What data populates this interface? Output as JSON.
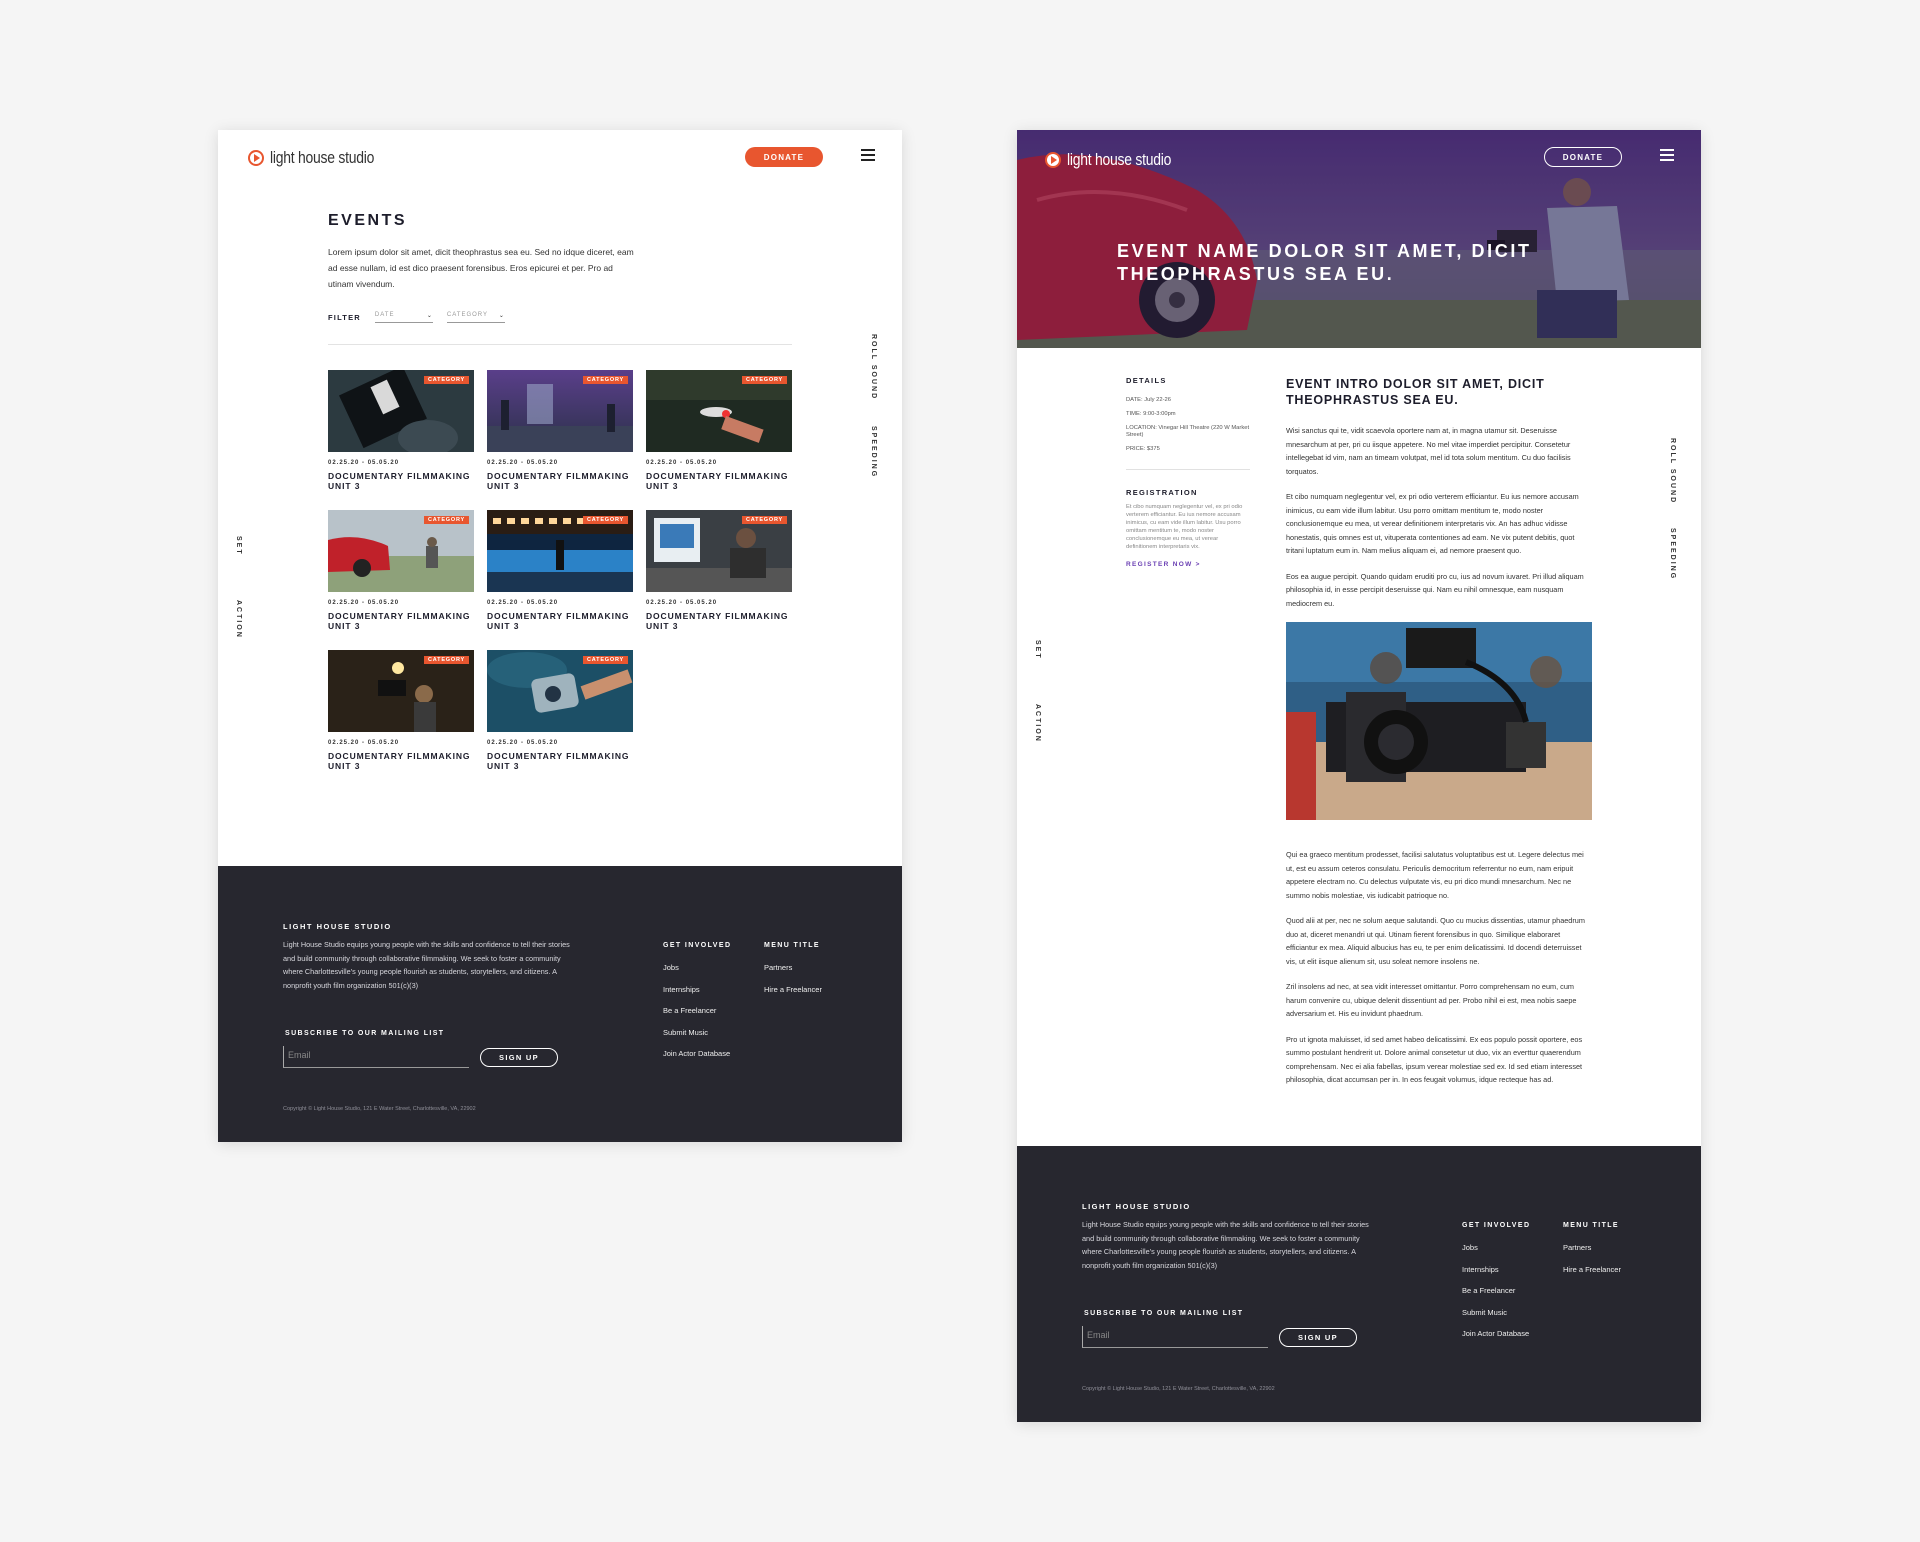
{
  "brand": {
    "logo_text": "light house studio",
    "accent": "#e8562f",
    "footer_bg": "#27272f",
    "link_color": "#6a3fb3"
  },
  "header": {
    "donate_label": "DONATE",
    "menu_icon": "hamburger-menu-icon"
  },
  "side_labels": {
    "set": "SET",
    "action": "ACTION",
    "roll_sound": "ROLL SOUND",
    "speeding": "SPEEDING"
  },
  "events": {
    "title": "EVENTS",
    "intro": "Lorem ipsum dolor sit amet, dicit theophrastus sea eu. Sed no idque diceret, eam ad esse nullam, id est dico praesent forensibus. Eros epicurei et per. Pro ad utinam vivendum.",
    "filter_label": "FILTER",
    "filter_date": "DATE",
    "filter_category": "CATEGORY",
    "cards": [
      {
        "tag": "CATEGORY",
        "date": "02.25.20 - 05.05.20",
        "title": "DOCUMENTARY FILMMAKING UNIT 3"
      },
      {
        "tag": "CATEGORY",
        "date": "02.25.20 - 05.05.20",
        "title": "DOCUMENTARY FILMMAKING UNIT 3"
      },
      {
        "tag": "CATEGORY",
        "date": "02.25.20 - 05.05.20",
        "title": "DOCUMENTARY FILMMAKING UNIT 3"
      },
      {
        "tag": "CATEGORY",
        "date": "02.25.20 - 05.05.20",
        "title": "DOCUMENTARY FILMMAKING UNIT 3"
      },
      {
        "tag": "CATEGORY",
        "date": "02.25.20 - 05.05.20",
        "title": "DOCUMENTARY FILMMAKING UNIT 3"
      },
      {
        "tag": "CATEGORY",
        "date": "02.25.20 - 05.05.20",
        "title": "DOCUMENTARY FILMMAKING UNIT 3"
      },
      {
        "tag": "CATEGORY",
        "date": "02.25.20 - 05.05.20",
        "title": "DOCUMENTARY FILMMAKING UNIT 3"
      },
      {
        "tag": "CATEGORY",
        "date": "02.25.20 - 05.05.20",
        "title": "DOCUMENTARY FILMMAKING UNIT 3"
      }
    ]
  },
  "detail": {
    "hero_title": "EVENT NAME DOLOR SIT AMET, DICIT THEOPHRASTUS SEA EU.",
    "details_label": "DETAILS",
    "date": "DATE: July 22-26",
    "time": "TIME: 9:00-3:00pm",
    "location": "LOCATION: Vinegar Hill Theatre (220 W Market Street)",
    "price": "PRICE: $375",
    "registration_label": "REGISTRATION",
    "registration_text": "Et cibo numquam neglegentur vel, ex pri odio verterem efficiantur. Eu ius nemore accusam inimicus, cu eam vide illum labitur. Usu porro omittam mentitum te, modo noster conclusionemque eu mea, ut verear definitionem interpretaris vix.",
    "register_link": "REGISTER NOW >",
    "intro_heading": "EVENT INTRO DOLOR SIT AMET, DICIT THEOPHRASTUS SEA EU.",
    "paragraphs": [
      "Wisi sanctus qui te, vidit scaevola oportere nam at, in magna utamur sit. Deseruisse mnesarchum at per, pri cu iisque appetere. No mel vitae imperdiet percipitur. Consetetur intellegebat id vim, nam an timeam volutpat, mel id tota solum mentitum. Cu duo facilisis torquatos.",
      "Et cibo numquam neglegentur vel, ex pri odio verterem efficiantur. Eu ius nemore accusam inimicus, cu eam vide illum labitur. Usu porro omittam mentitum te, modo noster conclusionemque eu mea, ut verear definitionem interpretaris vix. An has adhuc vidisse honestatis, quis omnes est ut, vituperata contentiones ad eam. Ne vix putent debitis, quot tritani luptatum eum in. Nam melius aliquam ei, ad nemore praesent quo.",
      "Eos ea augue percipit. Quando quidam eruditi pro cu, ius ad novum iuvaret. Pri illud aliquam philosophia id, in esse percipit deseruisse qui. Nam eu nihil omnesque, eam nusquam mediocrem eu."
    ],
    "lower_paragraphs": [
      "Qui ea graeco mentitum prodesset, facilisi salutatus voluptatibus est ut. Legere delectus mei ut, est eu assum ceteros consulatu. Periculis democritum referrentur no eum, nam eripuit appetere electram no. Cu delectus vulputate vis, eu pri dico mundi mnesarchum. Nec ne summo nobis molestiae, vis iudicabit patrioque no.",
      "Quod alii at per, nec ne solum aeque salutandi. Quo cu mucius dissentias, utamur phaedrum duo at, diceret menandri ut qui. Utinam fierent forensibus in quo. Similique elaboraret efficiantur ex mea. Aliquid albucius has eu, te per enim delicatissimi. Id docendi deterruisset vis, ut elit iisque alienum sit, usu soleat nemore insolens ne.",
      "Zril insolens ad nec, at sea vidit interesset omittantur. Porro comprehensam no eum, cum harum convenire cu, ubique delenit dissentiunt ad per. Probo nihil ei est, mea nobis saepe adversarium et. His eu invidunt phaedrum.",
      "Pro ut ignota maluisset, id sed amet habeo delicatissimi. Ex eos populo possit oportere, eos summo postulant hendrerit ut. Dolore animal consetetur ut duo, vix an everttur quaerendum comprehensam. Nec ei alia fabellas, ipsum verear molestiae sed ex. Id sed etiam interesset philosophia, dicat accumsan per in. In eos feugait volumus, idque recteque has ad."
    ]
  },
  "footer": {
    "heading": "LIGHT HOUSE STUDIO",
    "about": "Light House Studio equips young people with the skills and confidence to tell their stories and build community through collaborative filmmaking. We seek to foster a community where Charlottesville's young people flourish as students, storytellers, and citizens. A nonprofit youth film organization 501(c)(3)",
    "get_involved_heading": "GET INVOLVED",
    "get_involved_links": [
      "Jobs",
      "Internships",
      "Be a Freelancer",
      "Submit Music",
      "Join Actor Database"
    ],
    "menu_title_heading": "MENU TITLE",
    "menu_title_links": [
      "Partners",
      "Hire a Freelancer"
    ],
    "subscribe_heading": "SUBSCRIBE TO OUR MAILING LIST",
    "email_placeholder": "Email",
    "signup_label": "SIGN UP",
    "copyright": "Copyright © Light House Studio, 121 E Water Street, Charlottesville, VA, 22902"
  }
}
